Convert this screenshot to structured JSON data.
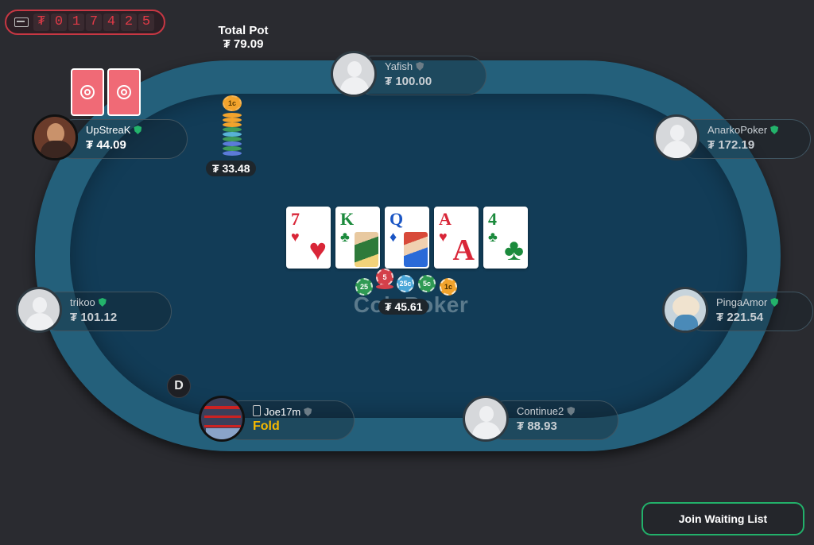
{
  "jackpot": {
    "icon": "ticket-icon",
    "currency": "₮",
    "digits": [
      "0",
      "1",
      "7",
      "4",
      "2",
      "5"
    ]
  },
  "total_pot": {
    "label": "Total Pot",
    "amount": "₮ 79.09"
  },
  "table": {
    "watermark": "CoinPoker",
    "felt_color": "#123c57",
    "rail_color": "#24607b"
  },
  "seats": {
    "yafish": {
      "name": "Yafish",
      "stack": "₮ 100.00"
    },
    "upstreak": {
      "name": "UpStreaK",
      "stack": "₮ 44.09",
      "bet": "₮ 33.48"
    },
    "anarko": {
      "name": "AnarkoPoker",
      "stack": "₮ 172.19"
    },
    "trikoo": {
      "name": "trikoo",
      "stack": "₮ 101.12"
    },
    "pinga": {
      "name": "PingaAmor",
      "stack": "₮ 221.54"
    },
    "joe": {
      "name": "Joe17m",
      "action": "Fold"
    },
    "continue2": {
      "name": "Continue2",
      "stack": "₮ 88.93"
    }
  },
  "board": {
    "cards": [
      {
        "rank": "7",
        "suit": "♥"
      },
      {
        "rank": "K",
        "suit": "♣"
      },
      {
        "rank": "Q",
        "suit": "♦"
      },
      {
        "rank": "A",
        "suit": "♥"
      },
      {
        "rank": "4",
        "suit": "♣"
      }
    ]
  },
  "pot": {
    "amount": "₮ 45.61",
    "chips": [
      "25",
      "5",
      "25c",
      "5c",
      "1c"
    ]
  },
  "chip_stack": {
    "top_label": "1c"
  },
  "dealer_button": "D",
  "join_waiting_list": "Join Waiting List"
}
